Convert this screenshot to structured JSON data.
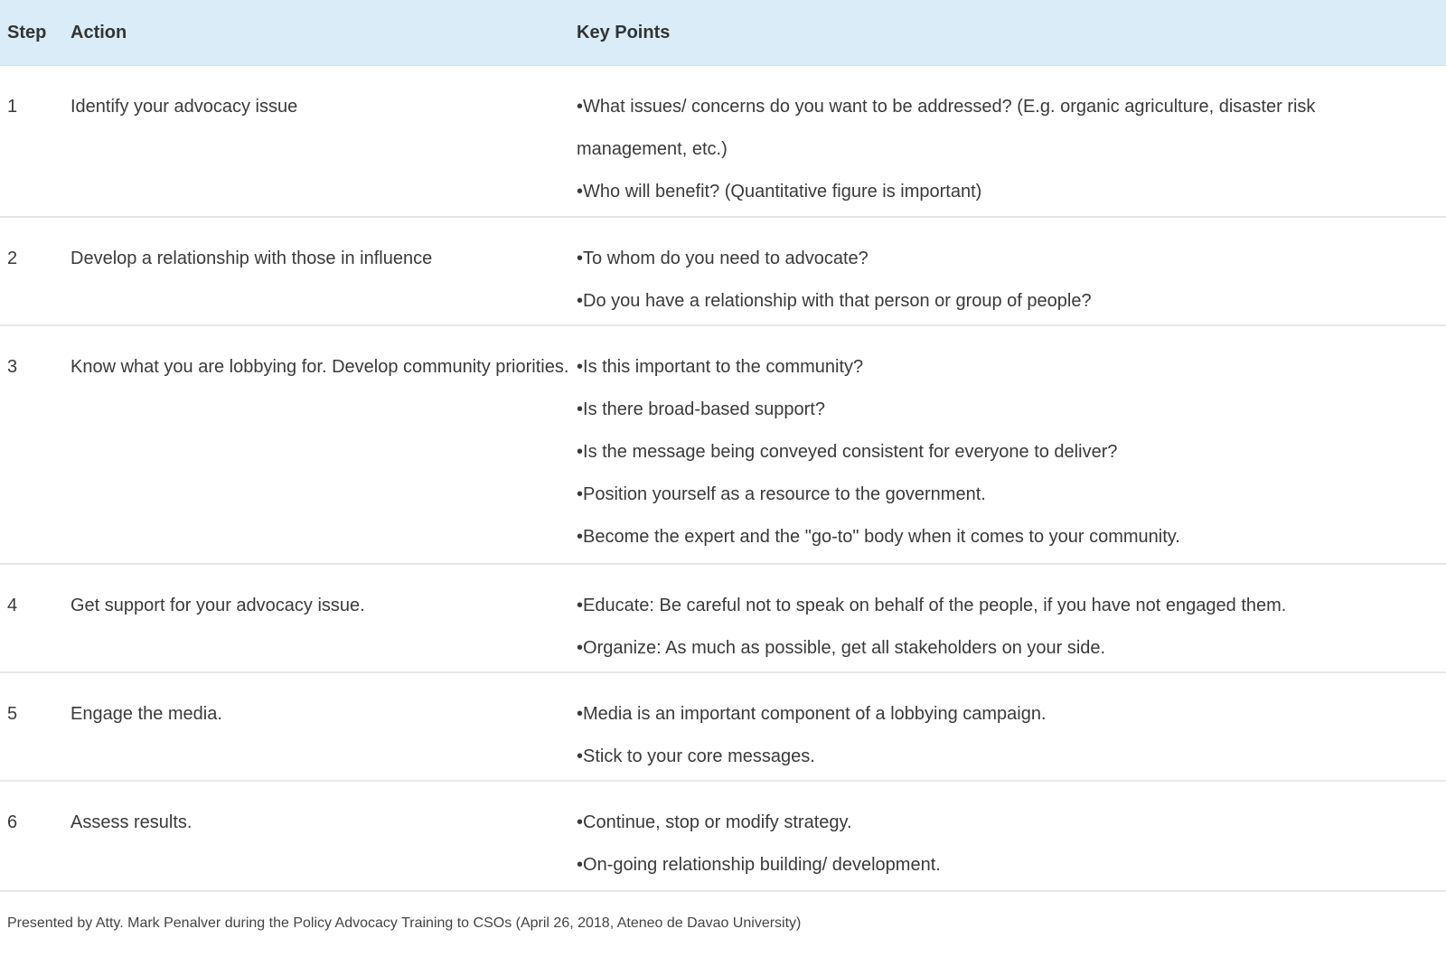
{
  "table": {
    "headers": {
      "step": "Step",
      "action": "Action",
      "key_points": "Key Points"
    },
    "rows": [
      {
        "step": "1",
        "action": "Identify your advocacy issue",
        "key_points": [
          "What issues/ concerns do you want to be addressed? (E.g. organic agriculture, disaster risk management, etc.)",
          "Who will benefit? (Quantitative figure is important)"
        ]
      },
      {
        "step": "2",
        "action": "Develop a relationship with those in influence",
        "key_points": [
          "To whom do you need to advocate?",
          "Do you have a relationship with that person or group of people?"
        ]
      },
      {
        "step": "3",
        "action": "Know what you are lobbying for. Develop community priorities.",
        "key_points": [
          "Is this important to the community?",
          "Is there broad-based support?",
          "Is the message being conveyed consistent for everyone to deliver?",
          "Position yourself as a resource to the government.",
          "Become the expert and the \"go-to\" body when it comes to your community."
        ]
      },
      {
        "step": "4",
        "action": "Get support for your advocacy issue.",
        "key_points": [
          "Educate: Be careful not to speak on behalf of the people, if you have not engaged them.",
          "Organize: As much as possible, get all stakeholders on your side."
        ]
      },
      {
        "step": "5",
        "action": "Engage the media.",
        "key_points": [
          "Media is an important component of a lobbying campaign.",
          "Stick to your core messages."
        ]
      },
      {
        "step": "6",
        "action": "Assess results.",
        "key_points": [
          "Continue, stop or modify strategy.",
          "On-going relationship building/ development."
        ]
      }
    ]
  },
  "caption": "Presented by Atty. Mark Penalver during the Policy Advocacy Training to CSOs (April 26, 2018, Ateneo de Davao University)",
  "colors": {
    "header_bg": "#d9ecf8",
    "row_divider": "#e6e6e6",
    "text": "#3a3a3a"
  }
}
